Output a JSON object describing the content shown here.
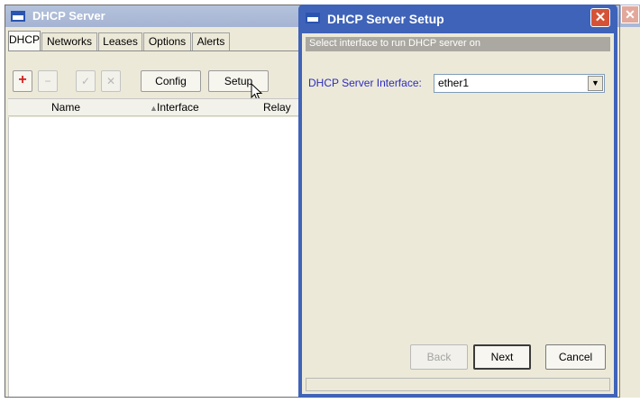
{
  "bg_window": {
    "title": "DHCP Server",
    "tabs": [
      "DHCP",
      "Networks",
      "Leases",
      "Options",
      "Alerts"
    ],
    "toolbar": {
      "add_label": "+",
      "remove_label": "−",
      "enable_label": "✓",
      "disable_label": "✕",
      "config_label": "Config",
      "setup_label": "Setup"
    },
    "columns": [
      "Name",
      "Interface",
      "Relay"
    ]
  },
  "dialog": {
    "title": "DHCP Server Setup",
    "close_label": "✕",
    "hint": "Select interface to run DHCP server on",
    "interface_label": "DHCP Server Interface:",
    "interface_value": "ether1",
    "back_label": "Back",
    "next_label": "Next",
    "cancel_label": "Cancel"
  },
  "edge_window": {
    "close_label": "✕"
  },
  "colors": {
    "accent_title": "#3f63b8",
    "close_red": "#d55237",
    "label_blue": "#2c2cc0"
  }
}
